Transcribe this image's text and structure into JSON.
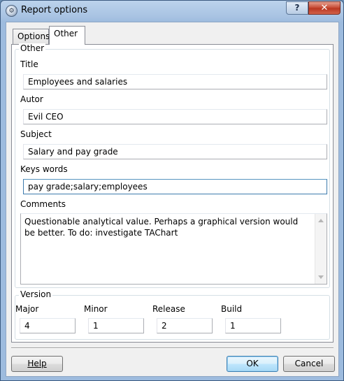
{
  "window": {
    "title": "Report options",
    "help_glyph": "?",
    "close_glyph": "✕",
    "app_icon": "app-gear-icon"
  },
  "tabs": [
    {
      "label": "Options",
      "active": false
    },
    {
      "label": "Other",
      "active": true
    }
  ],
  "other_group": {
    "legend": "Other",
    "title_label": "Title",
    "title_value": "Employees and salaries",
    "author_label": "Autor",
    "author_value": "Evil CEO",
    "subject_label": "Subject",
    "subject_value": "Salary and pay grade",
    "keywords_label": "Keys words",
    "keywords_value": "pay grade;salary;employees",
    "comments_label": "Comments",
    "comments_value": "Questionable analytical value. Perhaps a graphical version would be better. To do: investigate TAChart"
  },
  "version_group": {
    "legend": "Version",
    "major_label": "Major",
    "major_value": "4",
    "minor_label": "Minor",
    "minor_value": "1",
    "release_label": "Release",
    "release_value": "2",
    "build_label": "Build",
    "build_value": "1"
  },
  "buttons": {
    "help_label": "Help",
    "ok_label": "OK",
    "cancel_label": "Cancel"
  }
}
